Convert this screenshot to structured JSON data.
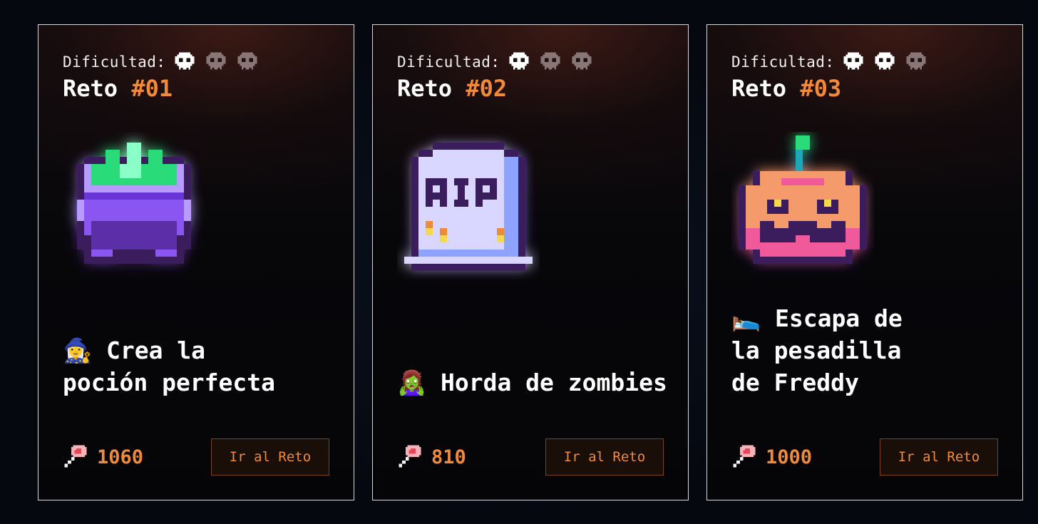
{
  "cards": [
    {
      "difficulty_label": "Dificultad:",
      "difficulty_level": 1,
      "difficulty_max": 3,
      "title_prefix": "Reto",
      "title_number": "#01",
      "emoji": "🧙‍♀️",
      "name": "Crea la\npoción perfecta",
      "score_icon": "lollipop-icon",
      "score": "1060",
      "button_label": "Ir al Reto",
      "art": "cauldron-icon"
    },
    {
      "difficulty_label": "Dificultad:",
      "difficulty_level": 1,
      "difficulty_max": 3,
      "title_prefix": "Reto",
      "title_number": "#02",
      "emoji": "🧟‍♀️",
      "name": "Horda de zombies",
      "score_icon": "lollipop-icon",
      "score": "810",
      "button_label": "Ir al Reto",
      "art": "tombstone-icon",
      "art_text": "RIP"
    },
    {
      "difficulty_label": "Dificultad:",
      "difficulty_level": 2,
      "difficulty_max": 3,
      "title_prefix": "Reto",
      "title_number": "#03",
      "emoji": "🛌",
      "name": "Escapa de\nla pesadilla\nde Freddy",
      "score_icon": "lollipop-icon",
      "score": "1000",
      "button_label": "Ir al Reto",
      "art": "jack-o-lantern-icon"
    }
  ],
  "colors": {
    "accent": "#f08a3a",
    "skull_active": "#ffffff",
    "skull_inactive": "#8a7676",
    "border": "#d9d9d9"
  }
}
